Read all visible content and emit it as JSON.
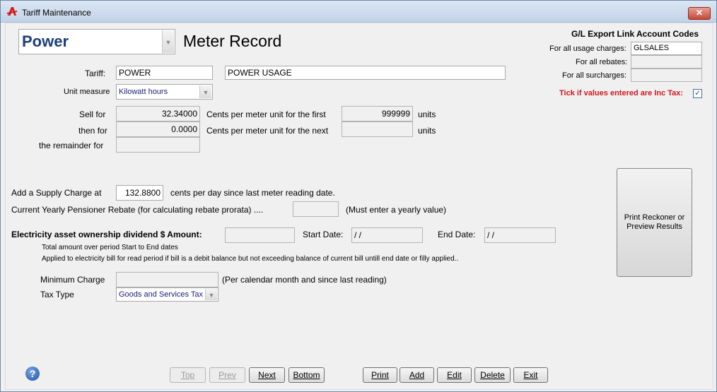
{
  "window": {
    "title": "Tariff Maintenance",
    "close_label": "✕"
  },
  "header": {
    "utility_value": "Power",
    "page_title": "Meter Record"
  },
  "gl": {
    "heading": "G/L Export Link Account Codes",
    "usage_label": "For all usage charges:",
    "usage_value": "GLSALES",
    "rebates_label": "For all rebates:",
    "rebates_value": "",
    "surcharges_label": "For all surcharges:",
    "surcharges_value": "",
    "inc_tax_label": "Tick if values entered are Inc Tax:",
    "inc_tax_checked": true
  },
  "tariff": {
    "label": "Tariff:",
    "code": "POWER",
    "description": "POWER USAGE",
    "unit_label": "Unit measure",
    "unit_value": "Kilowatt hours"
  },
  "rates": {
    "sell_label": "Sell for",
    "sell_value": "32.34000",
    "first_label": "Cents per meter unit for the first",
    "first_units": "999999",
    "units1": "units",
    "then_label": "then for",
    "then_value": "0.0000",
    "next_label": "Cents per meter unit for the next",
    "next_units": "",
    "units2": "units",
    "remainder_label": "the remainder for",
    "remainder_value": ""
  },
  "supply": {
    "label": "Add a Supply Charge at",
    "value": "132.8800",
    "suffix": "cents per day since last meter reading date."
  },
  "pensioner": {
    "label": "Current Yearly Pensioner Rebate (for calculating rebate prorata) ....",
    "value": "",
    "note": "(Must enter a yearly value)"
  },
  "dividend": {
    "label": "Electricity asset ownership dividend $ Amount:",
    "value": "",
    "start_label": "Start Date:",
    "start_value": " / /",
    "end_label": "End Date:",
    "end_value": " / /",
    "note1": "Total amount over period Start to End dates",
    "note2": "Applied to electricity bill for read period if bill is a debit balance but not exceeding balance of current bill untill end date or filly applied.."
  },
  "minimum": {
    "label": "Minimum Charge",
    "value": "",
    "note": "(Per calendar month and since last reading)"
  },
  "tax": {
    "label": "Tax Type",
    "value": "Goods and Services Tax"
  },
  "print_reckoner": "Print Reckoner or Preview Results",
  "buttons": {
    "top": "Top",
    "prev": "Prev",
    "next": "Next",
    "bottom": "Bottom",
    "print": "Print",
    "add": "Add",
    "edit": "Edit",
    "delete": "Delete",
    "exit": "Exit"
  },
  "help_label": "?"
}
